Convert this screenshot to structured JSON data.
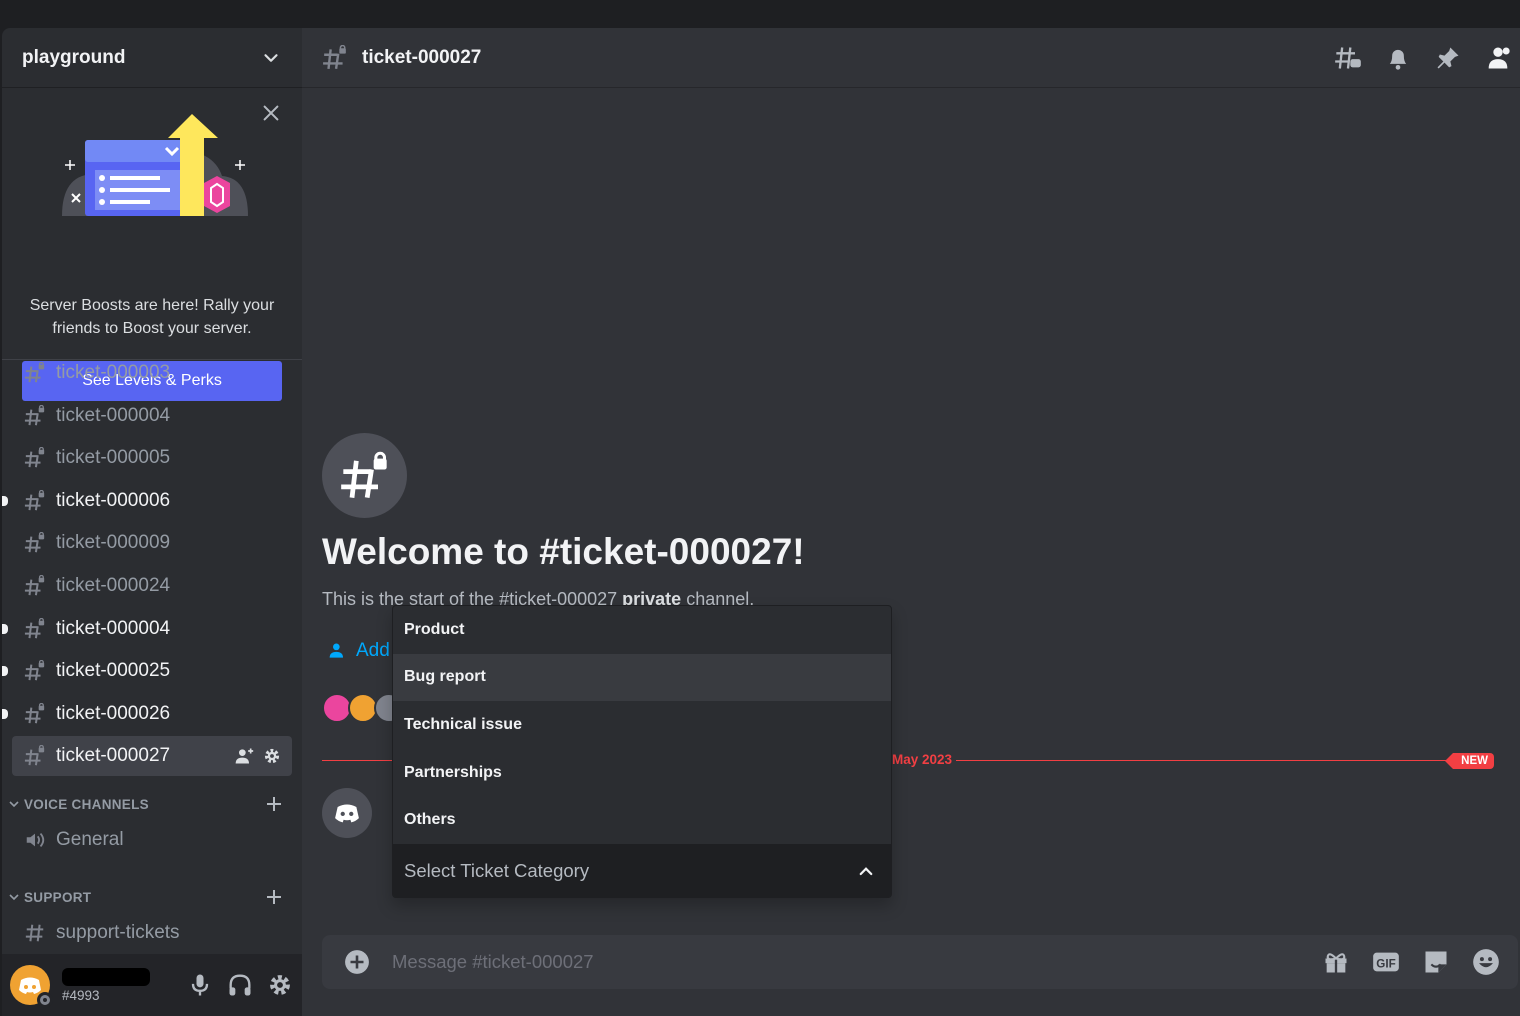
{
  "server": {
    "name": "playground"
  },
  "boost": {
    "text": "Server Boosts are here! Rally your friends to Boost your server.",
    "button_label": "See Levels & Perks"
  },
  "channels": [
    {
      "name": "ticket-000003",
      "unread": false
    },
    {
      "name": "ticket-000004",
      "unread": false
    },
    {
      "name": "ticket-000005",
      "unread": false
    },
    {
      "name": "ticket-000006",
      "unread": true
    },
    {
      "name": "ticket-000009",
      "unread": false
    },
    {
      "name": "ticket-000024",
      "unread": false
    },
    {
      "name": "ticket-000004",
      "unread": true
    },
    {
      "name": "ticket-000025",
      "unread": true
    },
    {
      "name": "ticket-000026",
      "unread": true
    },
    {
      "name": "ticket-000027",
      "unread": false,
      "active": true
    }
  ],
  "categories": {
    "voice": {
      "label": "VOICE CHANNELS",
      "channels": [
        "General"
      ]
    },
    "support": {
      "label": "SUPPORT",
      "channels": [
        "support-tickets"
      ]
    }
  },
  "user": {
    "name": "•••••••••",
    "tag": "#4993"
  },
  "header": {
    "channel": "ticket-000027"
  },
  "welcome": {
    "title": "Welcome to #ticket-000027!",
    "sub_start": "This is the start of the #ticket-000027 ",
    "sub_bold": "private",
    "sub_end": " channel.",
    "add_members": "Add"
  },
  "divider": {
    "date": "May 2023",
    "badge": "NEW"
  },
  "dropdown": {
    "options": [
      "Product",
      "Bug report",
      "Technical issue",
      "Partnerships",
      "Others"
    ],
    "hovered_index": 1,
    "placeholder": "Select Ticket Category"
  },
  "composer": {
    "placeholder": "Message #ticket-000027"
  },
  "colors": {
    "accent": "#5865f2",
    "danger": "#f23f43",
    "link": "#00a8fc"
  }
}
